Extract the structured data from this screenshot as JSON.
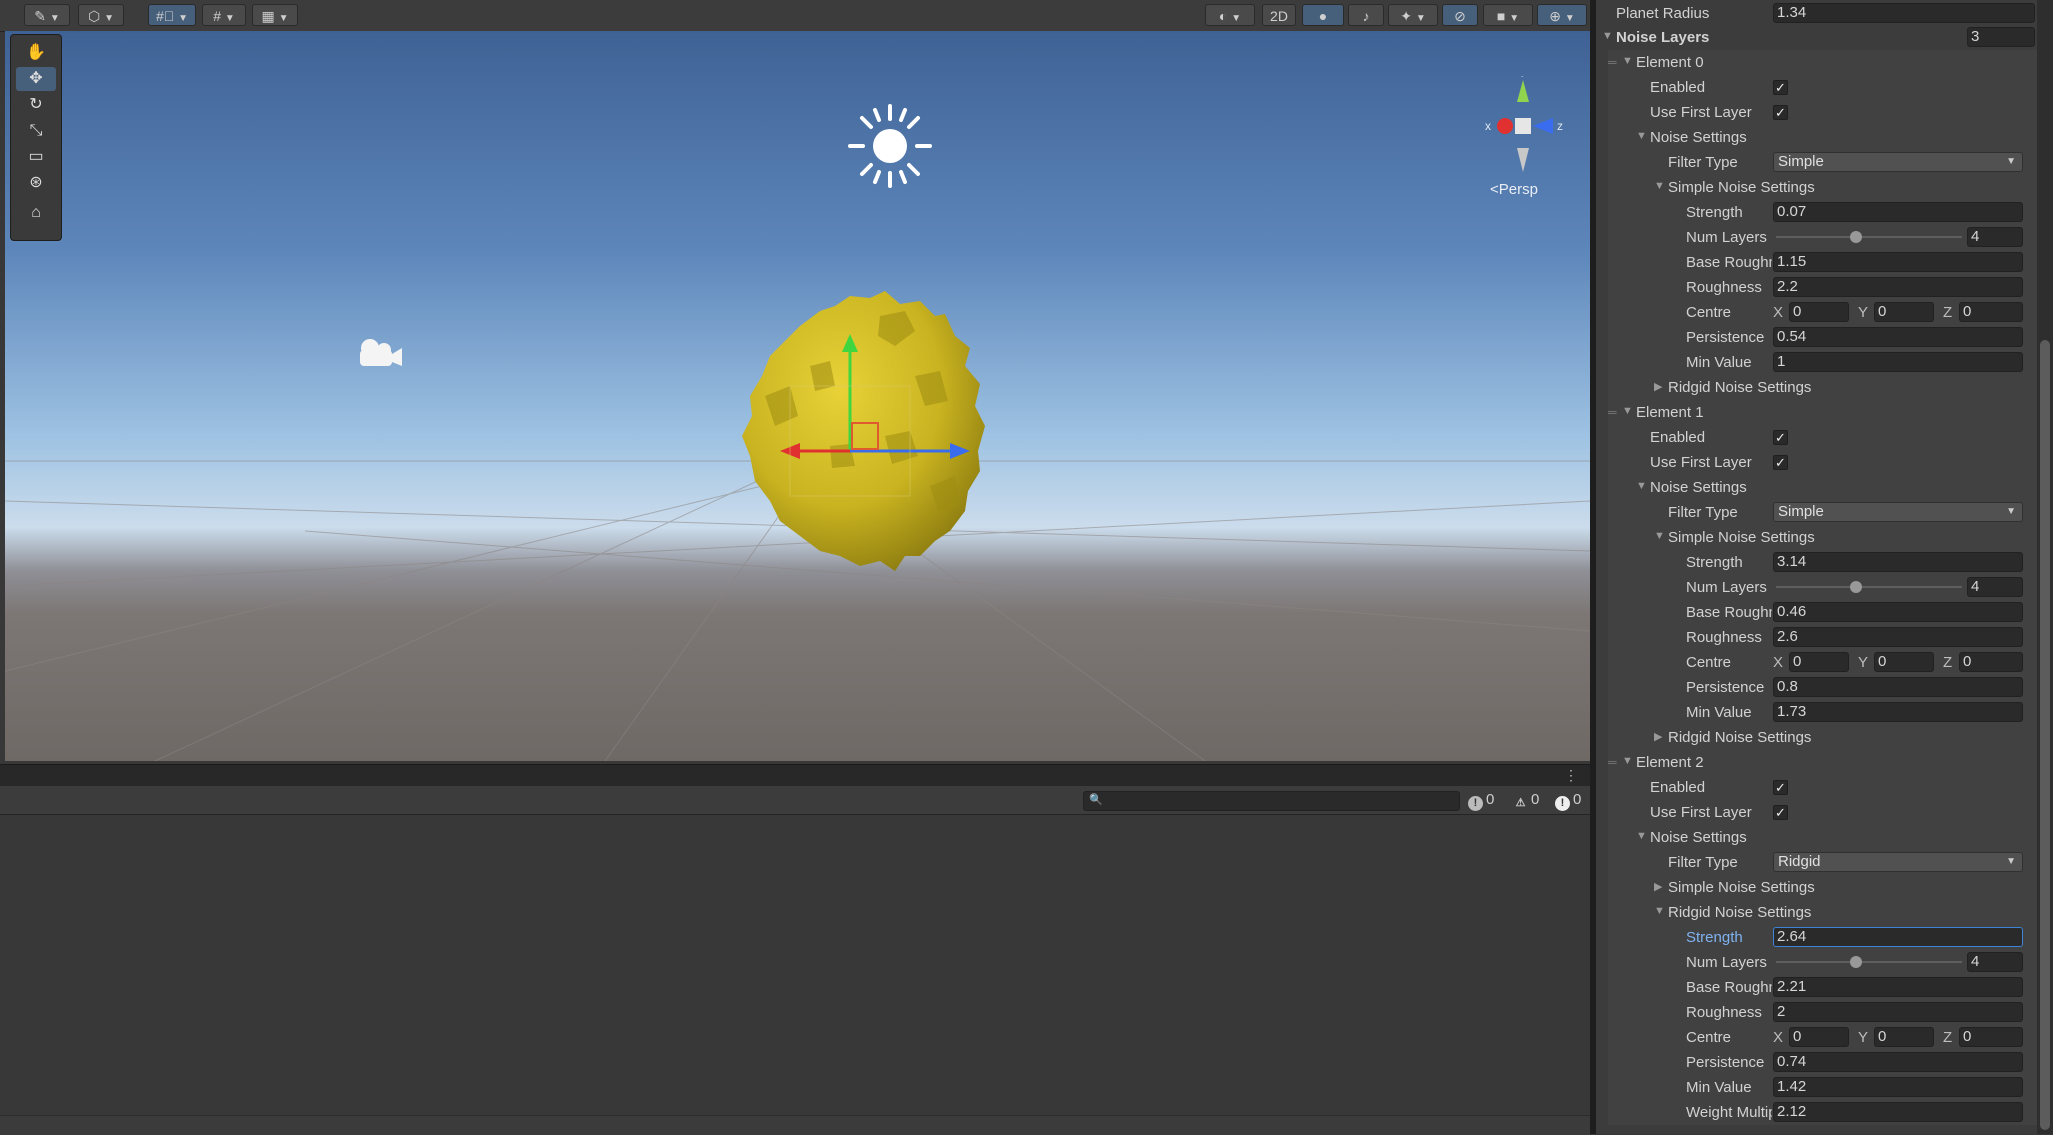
{
  "toolbar": {
    "buttons": [
      "paint-icon",
      "cube-icon",
      "grid-icon",
      "snap-grid-icon",
      "ruler-icon"
    ],
    "right_buttons": [
      "shading-icon",
      "2D",
      "light-icon",
      "audio-icon",
      "effects-icon",
      "hidden-icon",
      "camera-icon",
      "gizmos-icon"
    ],
    "mode_2d": "2D"
  },
  "scene": {
    "persp_label": "<Persp",
    "gizmo_axes": {
      "x": "x",
      "y": "y",
      "z": "z"
    },
    "colors": {
      "planet": "#c9b320",
      "sky_top": "#3f6295",
      "ground": "#6f6966"
    }
  },
  "console": {
    "search_placeholder": "",
    "counts": {
      "info": "0",
      "warning": "0",
      "error": "0"
    }
  },
  "inspector": {
    "planet_radius_label": "Planet Radius",
    "planet_radius": "1.34",
    "noise_layers_label": "Noise Layers",
    "noise_layers_count": "3",
    "elements": [
      {
        "title": "Element 0",
        "enabled_label": "Enabled",
        "use_first_label": "Use First Layer",
        "noise_settings_label": "Noise Settings",
        "filter_type_label": "Filter Type",
        "filter_type": "Simple",
        "simple_label": "Simple Noise Settings",
        "ridgid_label": "Ridgid Noise Settings",
        "open": "simple",
        "fields": {
          "strength_label": "Strength",
          "strength": "0.07",
          "num_layers_label": "Num Layers",
          "num_layers": "4",
          "base_roughness_label": "Base Roughness",
          "base_roughness": "1.15",
          "roughness_label": "Roughness",
          "roughness": "2.2",
          "centre_label": "Centre",
          "cx": "0",
          "cy": "0",
          "cz": "0",
          "persistence_label": "Persistence",
          "persistence": "0.54",
          "min_value_label": "Min Value",
          "min_value": "1"
        }
      },
      {
        "title": "Element 1",
        "enabled_label": "Enabled",
        "use_first_label": "Use First Layer",
        "noise_settings_label": "Noise Settings",
        "filter_type_label": "Filter Type",
        "filter_type": "Simple",
        "simple_label": "Simple Noise Settings",
        "ridgid_label": "Ridgid Noise Settings",
        "open": "simple",
        "fields": {
          "strength_label": "Strength",
          "strength": "3.14",
          "num_layers_label": "Num Layers",
          "num_layers": "4",
          "base_roughness_label": "Base Roughness",
          "base_roughness": "0.46",
          "roughness_label": "Roughness",
          "roughness": "2.6",
          "centre_label": "Centre",
          "cx": "0",
          "cy": "0",
          "cz": "0",
          "persistence_label": "Persistence",
          "persistence": "0.8",
          "min_value_label": "Min Value",
          "min_value": "1.73"
        }
      },
      {
        "title": "Element 2",
        "enabled_label": "Enabled",
        "use_first_label": "Use First Layer",
        "noise_settings_label": "Noise Settings",
        "filter_type_label": "Filter Type",
        "filter_type": "Ridgid",
        "simple_label": "Simple Noise Settings",
        "ridgid_label": "Ridgid Noise Settings",
        "open": "ridgid",
        "fields": {
          "strength_label": "Strength",
          "strength": "2.64",
          "num_layers_label": "Num Layers",
          "num_layers": "4",
          "base_roughness_label": "Base Roughness",
          "base_roughness": "2.21",
          "roughness_label": "Roughness",
          "roughness": "2",
          "centre_label": "Centre",
          "cx": "0",
          "cy": "0",
          "cz": "0",
          "persistence_label": "Persistence",
          "persistence": "0.74",
          "min_value_label": "Min Value",
          "min_value": "1.42",
          "weight_label": "Weight Multiplier",
          "weight": "2.12"
        }
      }
    ],
    "num_layers_slider_fraction": 0.43
  }
}
